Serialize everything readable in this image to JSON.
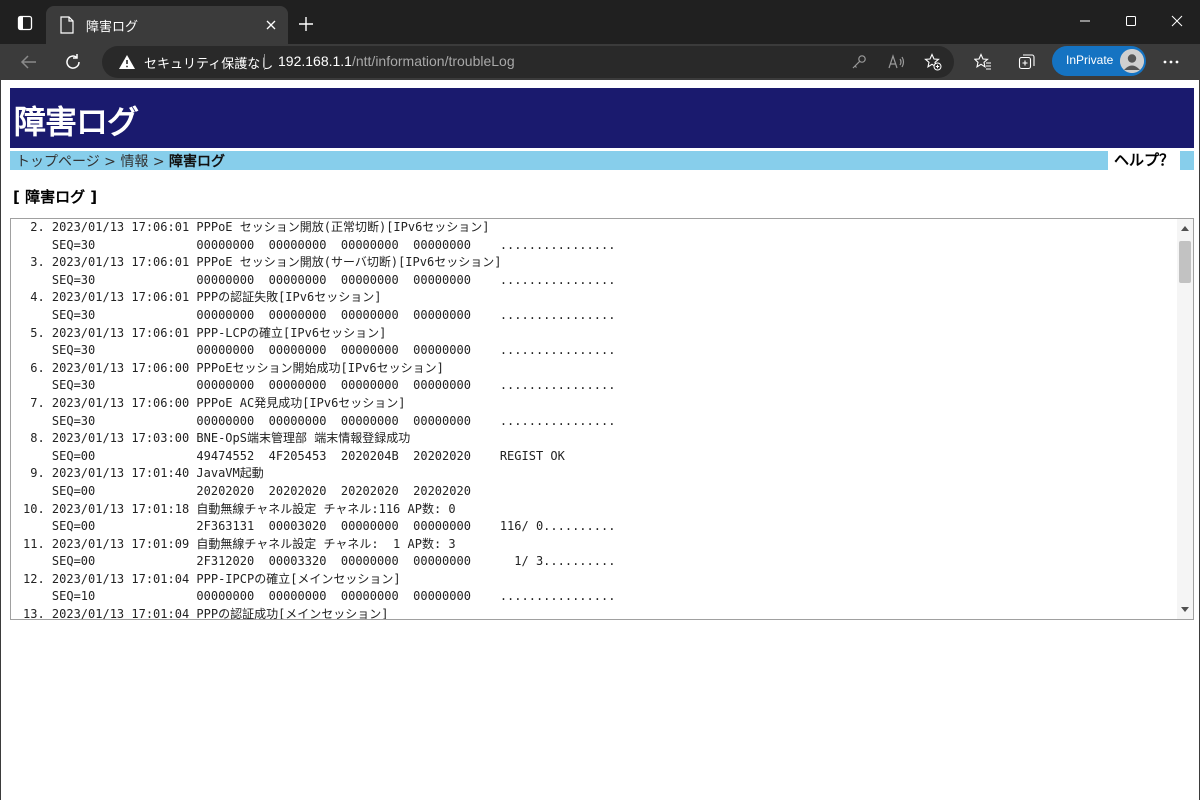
{
  "browser": {
    "tab_title": "障害ログ",
    "security_text": "セキュリティ保護なし",
    "url_host": "192.168.1.1",
    "url_path": "/ntt/information/troubleLog",
    "inprivate_label": "InPrivate"
  },
  "page": {
    "title": "障害ログ",
    "breadcrumb": {
      "top": "トップページ",
      "sep1": " > ",
      "info": "情報",
      "sep2": " > ",
      "current": "障害ログ"
    },
    "help_label": "ヘルプ？",
    "section_title": "[ 障害ログ ]"
  },
  "log_lines": [
    " 2. 2023/01/13 17:06:01 PPPoE セッション開放(正常切断)[IPv6セッション]",
    "    SEQ=30              00000000  00000000  00000000  00000000    ................",
    " 3. 2023/01/13 17:06:01 PPPoE セッション開放(サーバ切断)[IPv6セッション]",
    "    SEQ=30              00000000  00000000  00000000  00000000    ................",
    " 4. 2023/01/13 17:06:01 PPPの認証失敗[IPv6セッション]",
    "    SEQ=30              00000000  00000000  00000000  00000000    ................",
    " 5. 2023/01/13 17:06:01 PPP-LCPの確立[IPv6セッション]",
    "    SEQ=30              00000000  00000000  00000000  00000000    ................",
    " 6. 2023/01/13 17:06:00 PPPoEセッション開始成功[IPv6セッション]",
    "    SEQ=30              00000000  00000000  00000000  00000000    ................",
    " 7. 2023/01/13 17:06:00 PPPoE AC発見成功[IPv6セッション]",
    "    SEQ=30              00000000  00000000  00000000  00000000    ................",
    " 8. 2023/01/13 17:03:00 BNE-OpS端末管理部 端末情報登録成功",
    "    SEQ=00              49474552  4F205453  2020204B  20202020    REGIST OK",
    " 9. 2023/01/13 17:01:40 JavaVM起動",
    "    SEQ=00              20202020  20202020  20202020  20202020",
    "10. 2023/01/13 17:01:18 自動無線チャネル設定 チャネル:116 AP数: 0",
    "    SEQ=00              2F363131  00003020  00000000  00000000    116/ 0..........",
    "11. 2023/01/13 17:01:09 自動無線チャネル設定 チャネル:  1 AP数: 3",
    "    SEQ=00              2F312020  00003320  00000000  00000000      1/ 3..........",
    "12. 2023/01/13 17:01:04 PPP-IPCPの確立[メインセッション]",
    "    SEQ=10              00000000  00000000  00000000  00000000    ................",
    "13. 2023/01/13 17:01:04 PPPの認証成功[メインセッション]"
  ]
}
